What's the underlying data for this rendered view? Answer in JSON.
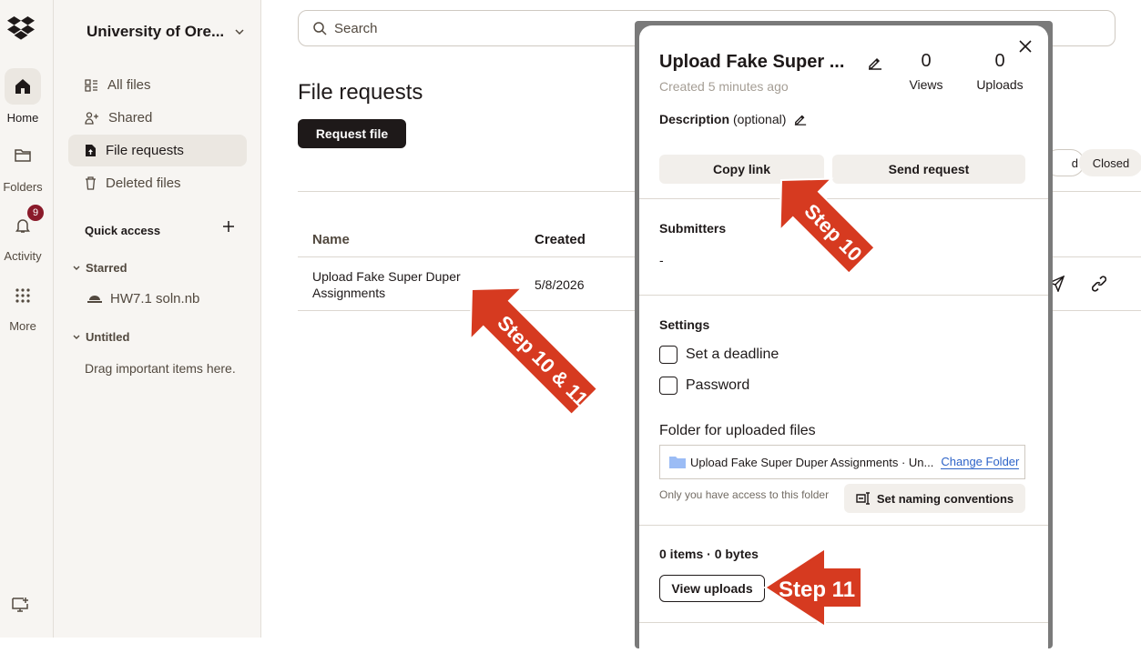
{
  "rail": {
    "home": "Home",
    "folders": "Folders",
    "activity": "Activity",
    "activity_badge": "9",
    "more": "More"
  },
  "sidebar": {
    "team_name": "University of Ore...",
    "items": [
      {
        "label": "All files"
      },
      {
        "label": "Shared"
      },
      {
        "label": "File requests"
      },
      {
        "label": "Deleted files"
      }
    ],
    "quick_access": "Quick access",
    "starred": "Starred",
    "starred_item": "HW7.1 soln.nb",
    "untitled": "Untitled",
    "drag_hint": "Drag important items here."
  },
  "main": {
    "search_placeholder": "Search",
    "title": "File requests",
    "request_button": "Request file",
    "filter_partial": "d",
    "filter_closed": "Closed",
    "table": {
      "col_name": "Name",
      "col_created": "Created",
      "rows": [
        {
          "name": "Upload Fake Super Duper Assignments",
          "created": "5/8/2026"
        }
      ]
    }
  },
  "panel": {
    "title": "Upload Fake Super ...",
    "created": "Created 5 minutes ago",
    "views_count": "0",
    "views_label": "Views",
    "uploads_count": "0",
    "uploads_label": "Uploads",
    "description_label": "Description",
    "description_optional": "(optional)",
    "copy_link": "Copy link",
    "send_request": "Send request",
    "submitters_label": "Submitters",
    "submitters_value": "-",
    "settings_label": "Settings",
    "deadline": "Set a deadline",
    "password": "Password",
    "folder_label": "Folder for uploaded files",
    "folder_name": "Upload Fake Super Duper Assignments · Un...",
    "change_folder": "Change Folder",
    "access_note": "Only you have access to this folder",
    "naming_conventions": "Set naming conventions",
    "items_summary": "0 items · 0 bytes",
    "view_uploads": "View uploads"
  },
  "annotations": {
    "step_10_11": "Step 10 & 11",
    "step_10": "Step 10",
    "step_11": "Step 11",
    "arrow_color": "#d63a20"
  }
}
